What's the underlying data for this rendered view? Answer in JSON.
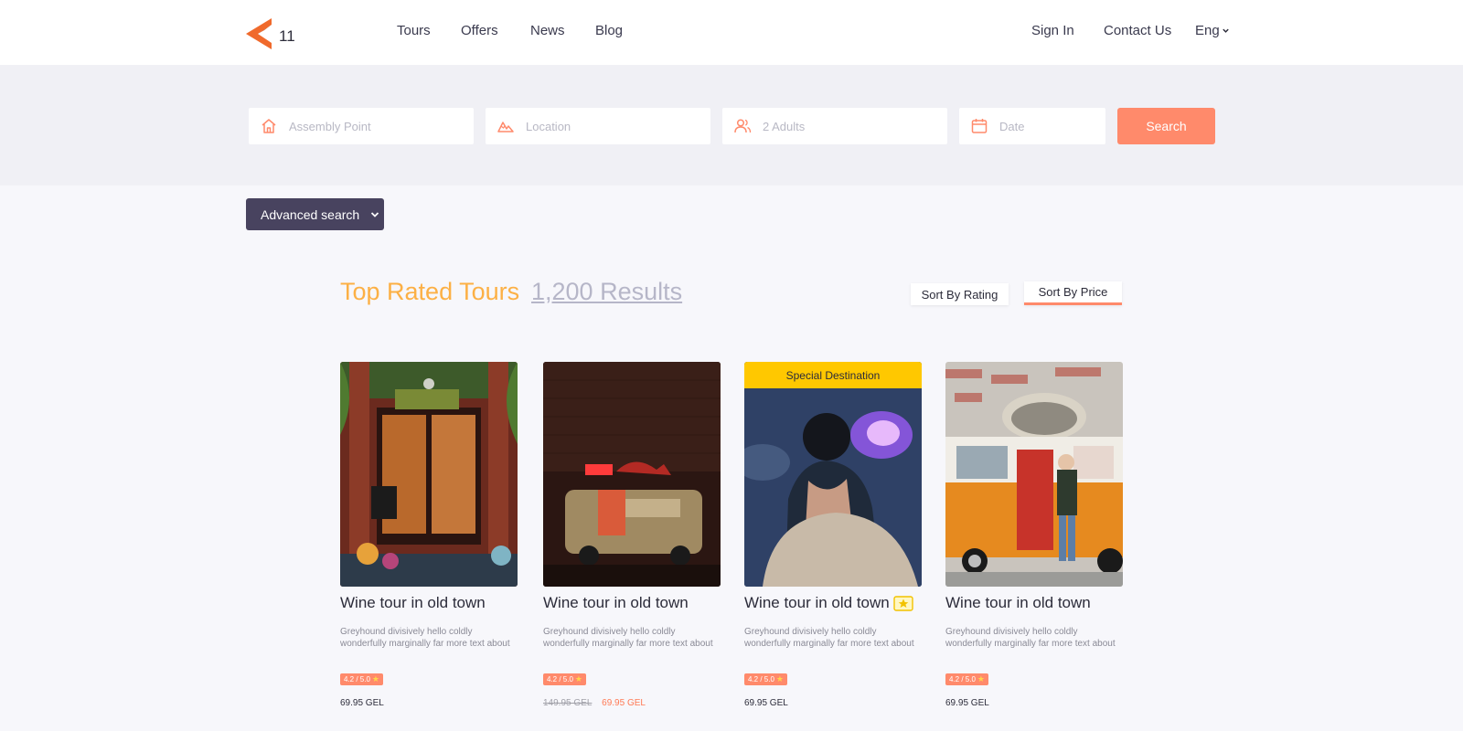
{
  "header": {
    "logo_number": "11",
    "nav": [
      "Tours",
      "Offers",
      "News",
      "Blog"
    ],
    "sign_in": "Sign In",
    "contact": "Contact Us",
    "language": "Eng"
  },
  "search": {
    "assembly_placeholder": "Assembly Point",
    "location_placeholder": "Location",
    "adults_placeholder": "2 Adults",
    "date_placeholder": "Date",
    "button": "Search"
  },
  "advanced_search": "Advanced search",
  "results": {
    "title": "Top Rated Tours",
    "count": "1,200 Results",
    "sort_rating": "Sort By Rating",
    "sort_price": "Sort By Price"
  },
  "cards": [
    {
      "title": "Wine tour in old town",
      "description": "Greyhound divisively hello coldly wonderfully marginally far more text about",
      "rating": "4.2 / 5.0",
      "price": "69.95 GEL",
      "old_price": "",
      "badge": ""
    },
    {
      "title": "Wine tour in old town",
      "description": "Greyhound divisively hello coldly wonderfully marginally far more text about",
      "rating": "4.2 / 5.0",
      "price": "69.95 GEL",
      "old_price": "149.95 GEL",
      "badge": ""
    },
    {
      "title": "Wine tour in old town",
      "description": "Greyhound divisively hello coldly wonderfully marginally far more text about",
      "rating": "4.2 / 5.0",
      "price": "69.95 GEL",
      "old_price": "",
      "badge": "Special Destination"
    },
    {
      "title": "Wine tour in old town",
      "description": "Greyhound divisively hello coldly wonderfully marginally far more text about",
      "rating": "4.2 / 5.0",
      "price": "69.95 GEL",
      "old_price": "",
      "badge": ""
    }
  ],
  "colors": {
    "accent": "#ff8a6b",
    "title_orange": "#fcb045",
    "dark_button": "#48435f",
    "badge_yellow": "#ffc800"
  }
}
